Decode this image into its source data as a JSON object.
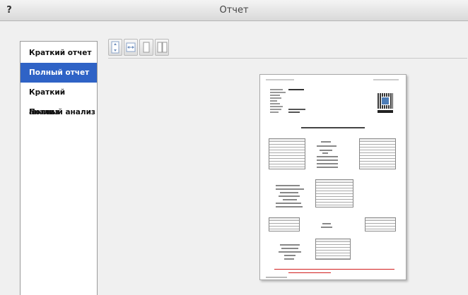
{
  "window": {
    "title": "Отчет",
    "help_label": "?"
  },
  "sidebar": {
    "items": [
      {
        "label": "Краткий отчет",
        "active": false
      },
      {
        "label": "Полный отчет",
        "active": true
      },
      {
        "label": "Краткий анализ",
        "active": false
      },
      {
        "label": "Полный анализ",
        "active": false
      }
    ]
  },
  "toolbar": {
    "buttons": [
      {
        "icon": "fit-height-icon"
      },
      {
        "icon": "fit-width-icon"
      },
      {
        "icon": "single-page-icon"
      },
      {
        "icon": "two-pages-icon"
      }
    ]
  },
  "colors": {
    "active_item": "#2f63c6",
    "accent_red": "#d21f1f"
  }
}
